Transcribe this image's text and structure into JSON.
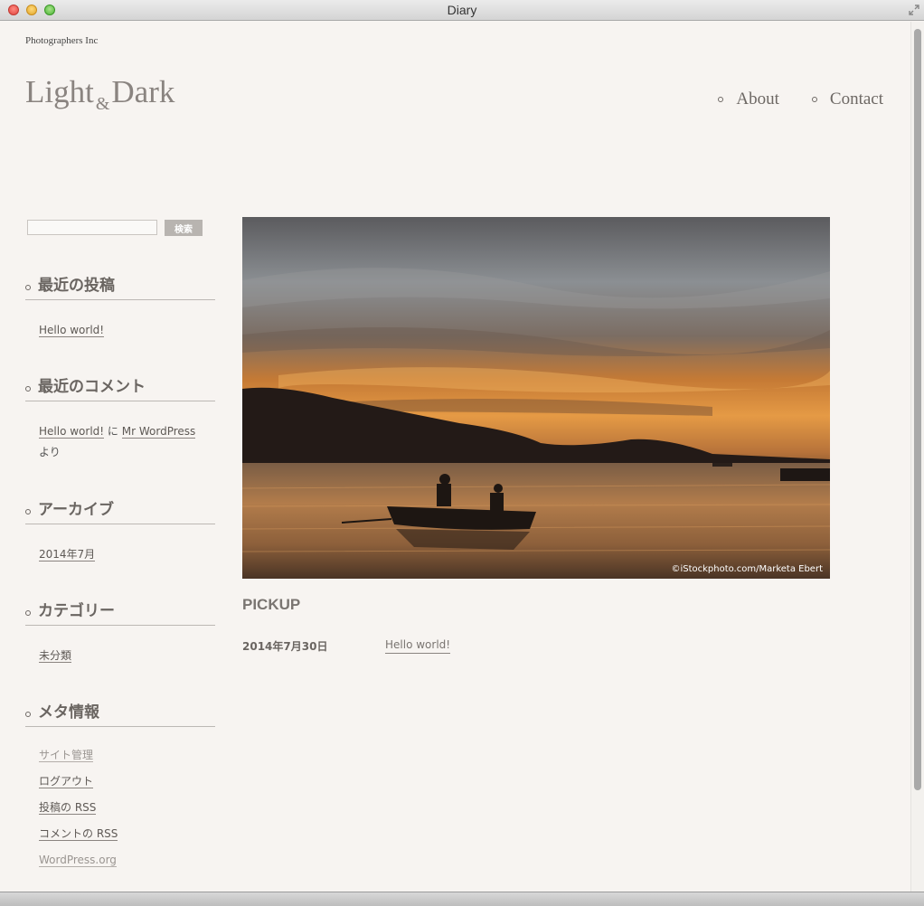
{
  "window": {
    "title": "Diary"
  },
  "site": {
    "company": "Photographers Inc",
    "logo_part1": "Light",
    "logo_amp": "&",
    "logo_part2": "Dark"
  },
  "nav": [
    {
      "label": "About"
    },
    {
      "label": "Contact"
    }
  ],
  "search": {
    "value": "",
    "placeholder": "",
    "button_label": "検索"
  },
  "widgets": {
    "recent_posts": {
      "title": "最近の投稿",
      "items": [
        "Hello world!"
      ]
    },
    "recent_comments": {
      "title": "最近のコメント",
      "post_link": "Hello world!",
      "connector": "に",
      "author_link": "Mr WordPress",
      "suffix": "より"
    },
    "archives": {
      "title": "アーカイブ",
      "items": [
        "2014年7月"
      ]
    },
    "categories": {
      "title": "カテゴリー",
      "items": [
        "未分類"
      ]
    },
    "meta": {
      "title": "メタ情報",
      "items": [
        "サイト管理",
        "ログアウト",
        "投稿の RSS",
        "コメントの RSS",
        "WordPress.org"
      ]
    }
  },
  "hero": {
    "credit": "©iStockphoto.com/Marketa Ebert"
  },
  "pickup": {
    "heading": "PICKUP",
    "date": "2014年7月30日",
    "post_title": "Hello world!"
  },
  "colors": {
    "background": "#f7f4f1",
    "text": "#6a6561",
    "accent": "#8a8480"
  }
}
